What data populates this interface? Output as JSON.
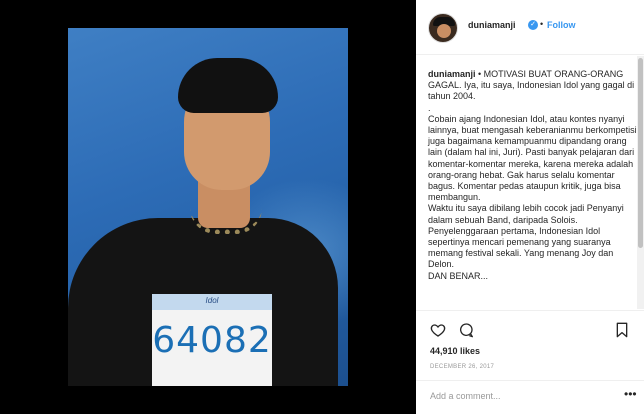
{
  "post": {
    "username": "duniamanji",
    "follow_label": "Follow",
    "separator": "•",
    "verified_glyph": "✓",
    "image": {
      "bib_number": "64082",
      "bib_logo": "Idol"
    },
    "caption": {
      "username": "duniamanji",
      "lines": [
        "• MOTIVASI BUAT ORANG-ORANG GAGAL. Iya, itu saya, Indonesian Idol yang gagal di tahun 2004.",
        ".",
        "Cobain ajang Indonesian Idol, atau kontes nyanyi lainnya, buat mengasah keberanianmu berkompetisi juga bagaimana kemampuanmu dipandang orang lain (dalam hal ini, Juri). Pasti banyak pelajaran dari komentar-komentar mereka, karena mereka adalah orang-orang hebat. Gak harus selalu komentar bagus. Komentar pedas ataupun kritik, juga bisa membangun.",
        "Waktu itu saya dibilang lebih cocok jadi Penyanyi dalam sebuah Band, daripada Solois. Penyelenggaraan pertama, Indonesian Idol sepertinya mencari pemenang yang suaranya memang festival sekali. Yang menang Joy dan Delon.",
        "DAN BENAR..."
      ]
    },
    "likes": "44,910 likes",
    "date": "DECEMBER 26, 2017",
    "comment_placeholder": "Add a comment...",
    "more_glyph": "•••"
  },
  "icons": {
    "heart": "heart-icon",
    "comment": "comment-icon",
    "bookmark": "bookmark-icon"
  }
}
